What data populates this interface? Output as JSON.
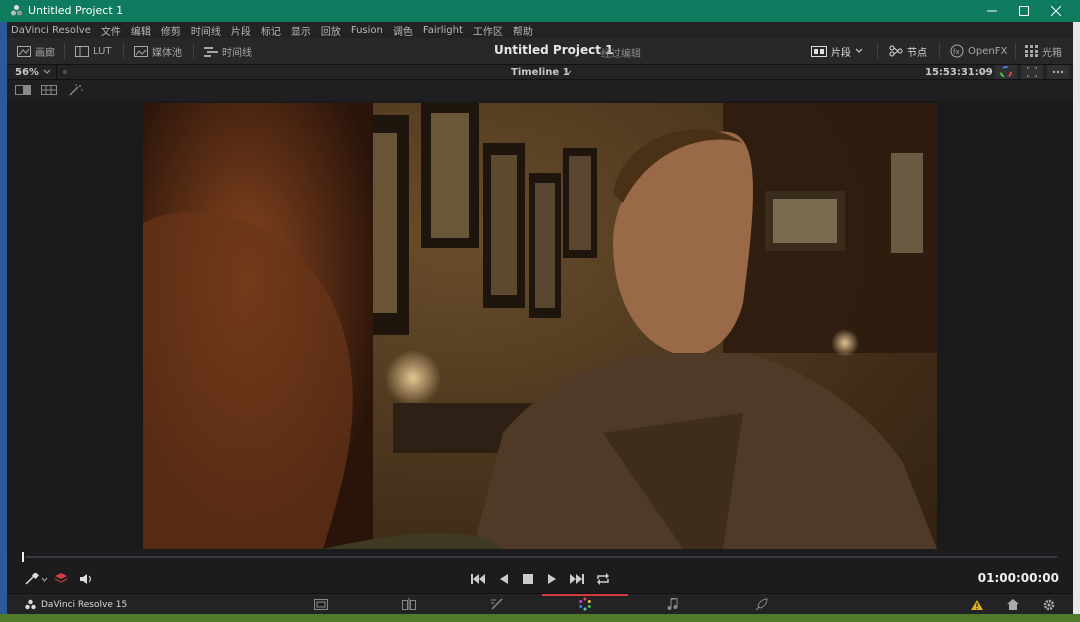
{
  "window": {
    "title": "Untitled Project 1",
    "titlebar_color": "#0f7b5e"
  },
  "menu": [
    "DaVinci Resolve",
    "文件",
    "编辑",
    "修剪",
    "时间线",
    "片段",
    "标记",
    "显示",
    "回放",
    "Fusion",
    "调色",
    "Fairlight",
    "工作区",
    "帮助"
  ],
  "toolbar": {
    "gallery": "画廊",
    "lut": "LUT",
    "media_pool": "媒体池",
    "timeline": "时间线",
    "project_title": "Untitled Project 1",
    "project_sub": "经过编辑",
    "clips": "片段",
    "nodes": "节点",
    "openfx": "OpenFX",
    "lightbox": "光箱"
  },
  "viewer": {
    "zoom": "56%",
    "timeline_name": "Timeline 1",
    "timecode_top": "15:53:31:09",
    "timecode_bottom": "01:00:00:00"
  },
  "pages": {
    "brand": "DaVinci Resolve 15",
    "icons": [
      "media-page-icon",
      "cut-page-icon",
      "edit-page-icon",
      "color-page-icon",
      "fairlight-page-icon",
      "deliver-page-icon"
    ],
    "active": "color-page-icon",
    "accent": "#d33b3b"
  }
}
